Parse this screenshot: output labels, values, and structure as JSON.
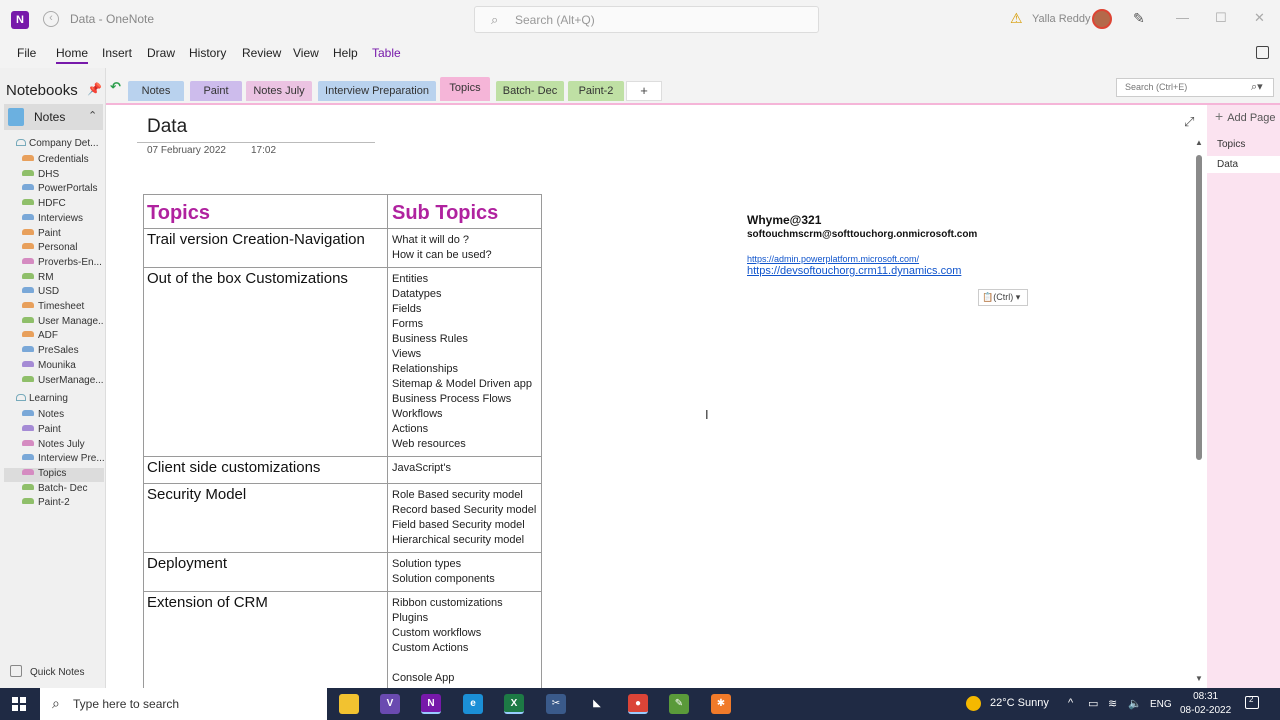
{
  "window": {
    "title": "Data  -  OneNote",
    "search_placeholder": "Search (Alt+Q)",
    "user_name": "Yalla Reddy"
  },
  "menu": [
    "File",
    "Home",
    "Insert",
    "Draw",
    "History",
    "Review",
    "View",
    "Help",
    "Table"
  ],
  "notebooks_header": "Notebooks",
  "current_notebook": "Notes",
  "notebook_groups": [
    {
      "label": "Company Det...",
      "sections": [
        {
          "label": "Credentials",
          "color": "#e8a05c"
        },
        {
          "label": "DHS",
          "color": "#8fbf6a"
        },
        {
          "label": "PowerPortals",
          "color": "#7aa8d8"
        },
        {
          "label": "HDFC",
          "color": "#8fbf6a"
        },
        {
          "label": "Interviews",
          "color": "#7aa8d8"
        },
        {
          "label": "Paint",
          "color": "#e8a05c"
        },
        {
          "label": "Personal",
          "color": "#e8a05c"
        },
        {
          "label": "Proverbs-En...",
          "color": "#d58bc1"
        },
        {
          "label": "RM",
          "color": "#8fbf6a"
        },
        {
          "label": "USD",
          "color": "#7aa8d8"
        },
        {
          "label": "Timesheet",
          "color": "#e8a05c"
        },
        {
          "label": "User Manage...",
          "color": "#8fbf6a"
        },
        {
          "label": "ADF",
          "color": "#e8a05c"
        },
        {
          "label": "PreSales",
          "color": "#7aa8d8"
        },
        {
          "label": "Mounika",
          "color": "#a58bd5"
        },
        {
          "label": "UserManage...",
          "color": "#8fbf6a"
        }
      ]
    },
    {
      "label": "Learning",
      "sections": [
        {
          "label": "Notes",
          "color": "#7aa8d8"
        },
        {
          "label": "Paint",
          "color": "#a58bd5"
        },
        {
          "label": "Notes July",
          "color": "#d58bc1"
        },
        {
          "label": "Interview Pre...",
          "color": "#7aa8d8"
        },
        {
          "label": "Topics",
          "color": "#d58bc1",
          "selected": true
        },
        {
          "label": "Batch- Dec",
          "color": "#8fbf6a"
        },
        {
          "label": "Paint-2",
          "color": "#8fbf6a"
        }
      ]
    }
  ],
  "quick_notes": "Quick Notes",
  "section_tabs": [
    {
      "label": "Notes",
      "color": "#b9d2ee"
    },
    {
      "label": "Paint",
      "color": "#cdbcec"
    },
    {
      "label": "Notes July",
      "color": "#ebc3e2"
    },
    {
      "label": "Interview Preparation",
      "color": "#b9d2ee"
    },
    {
      "label": "Topics",
      "color": "#f5b5d8",
      "active": true
    },
    {
      "label": "Batch- Dec",
      "color": "#bfe0a4"
    },
    {
      "label": "Paint-2",
      "color": "#bfe0a4"
    }
  ],
  "add_tab": "+",
  "page_search_placeholder": "Search (Ctrl+E)",
  "page": {
    "title": "Data",
    "date": "07 February 2022",
    "time": "17:02"
  },
  "table": {
    "headers": [
      "Topics",
      "Sub Topics"
    ],
    "rows": [
      {
        "topic": "Trail version Creation-Navigation",
        "subs": [
          " What it will do ?",
          " How it can be used?"
        ]
      },
      {
        "topic": "Out of the box Customizations",
        "subs": [
          "Entities",
          "Datatypes",
          "Fields",
          "Forms",
          "Business Rules",
          "Views",
          "Relationships",
          "Sitemap & Model Driven app",
          "Business Process Flows",
          "Workflows",
          "Actions",
          "Web resources"
        ]
      },
      {
        "topic": "Client side customizations",
        "subs": [
          "JavaScript's"
        ]
      },
      {
        "topic": "Security Model",
        "subs": [
          "Role Based security model",
          "Record based Security model",
          "Field based Security model",
          "Hierarchical security model"
        ]
      },
      {
        "topic": "Deployment",
        "subs": [
          "Solution types",
          "Solution components"
        ]
      },
      {
        "topic": "Extension of CRM",
        "subs": [
          "Ribbon customizations",
          "Plugins",
          "Custom workflows",
          "Custom Actions",
          "",
          "Console App"
        ]
      }
    ]
  },
  "credentials_note": {
    "line1": "Whyme@321",
    "line2": "softouchmscrm@softtouchorg.onmicrosoft.com",
    "link1": "https://admin.powerplatform.microsoft.com/",
    "link2": "https://devsoftouchorg.crm11.dynamics.com"
  },
  "paste_options": "(Ctrl)",
  "pages_panel": {
    "add_page": "Add Page",
    "section_label": "Topics",
    "pages": [
      "Data"
    ]
  },
  "taskbar": {
    "search_placeholder": "Type here to search",
    "weather": "22°C  Sunny",
    "language": "ENG",
    "time": "08:31",
    "date": "08-02-2022",
    "notification_count": "2",
    "apps": [
      {
        "name": "file-explorer",
        "glyph": "",
        "color": "#f2c230"
      },
      {
        "name": "visual-studio",
        "glyph": "V",
        "color": "#6a4ab0"
      },
      {
        "name": "onenote",
        "glyph": "N",
        "color": "#7719aa"
      },
      {
        "name": "edge",
        "glyph": "e",
        "color": "#1b8fd6"
      },
      {
        "name": "excel",
        "glyph": "X",
        "color": "#1d7a45"
      },
      {
        "name": "snipping-tool",
        "glyph": "✂",
        "color": "#3a5a8a"
      },
      {
        "name": "dynamics",
        "glyph": "◣",
        "color": "#1f2a44"
      },
      {
        "name": "chrome",
        "glyph": "●",
        "color": "#db4437"
      },
      {
        "name": "notepad",
        "glyph": "✎",
        "color": "#5a9a3a"
      },
      {
        "name": "postman",
        "glyph": "✱",
        "color": "#f07a2a"
      }
    ]
  }
}
